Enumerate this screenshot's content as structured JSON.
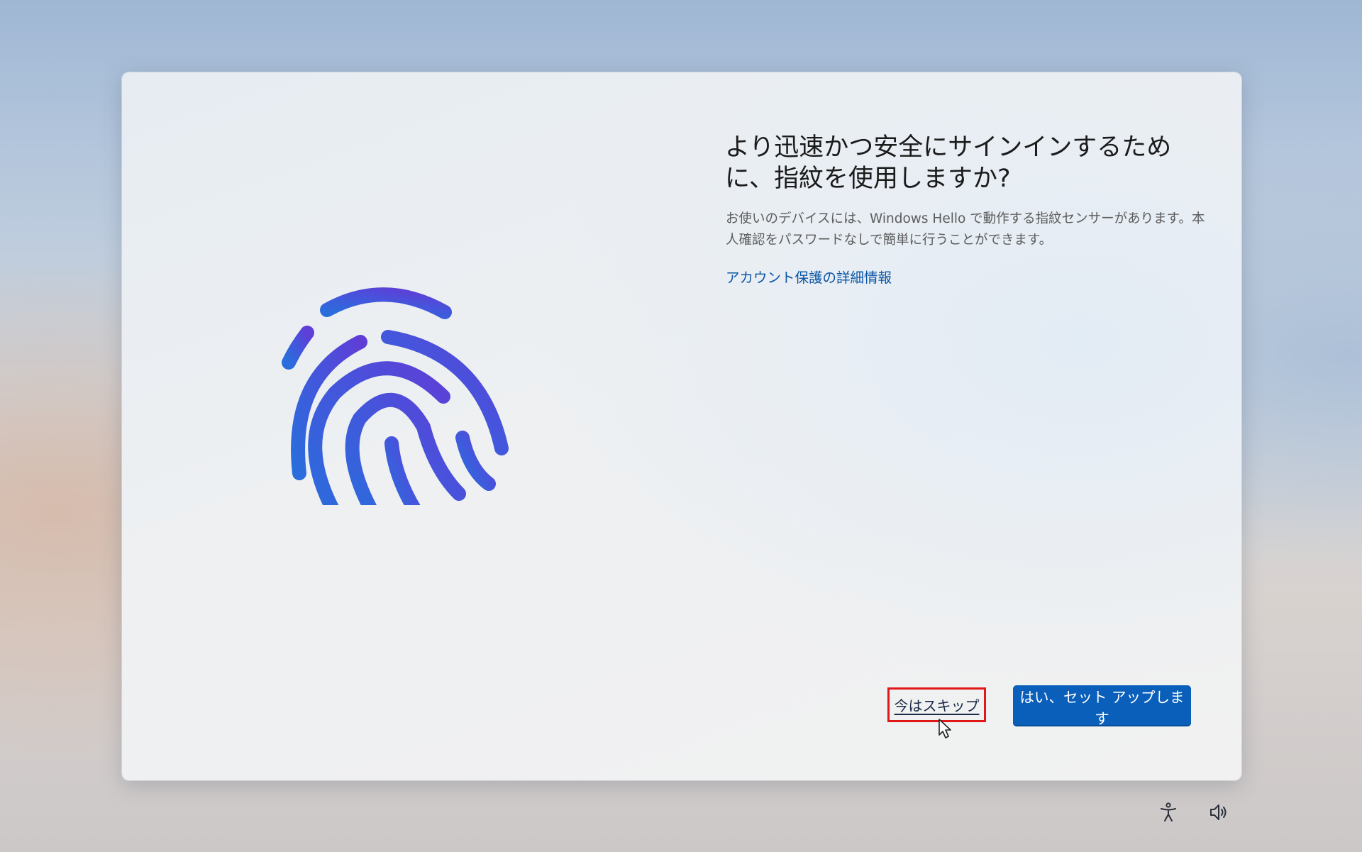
{
  "dialog": {
    "title": "より迅速かつ安全にサインインするために、指紋を使用しますか?",
    "description": "お使いのデバイスには、Windows Hello で動作する指紋センサーがあります。本人確認をパスワードなしで簡単に行うことができます。",
    "learn_more_link": "アカウント保護の詳細情報",
    "skip_label": "今はスキップ",
    "primary_label": "はい、セット アップします"
  },
  "tray": {
    "icons": [
      "accessibility-icon",
      "volume-icon"
    ]
  },
  "colors": {
    "accent": "#0a5fba",
    "link": "#0a55a6",
    "highlight_box": "#e01818",
    "fingerprint_start": "#2c6bdc",
    "fingerprint_end": "#5b3fd8"
  }
}
